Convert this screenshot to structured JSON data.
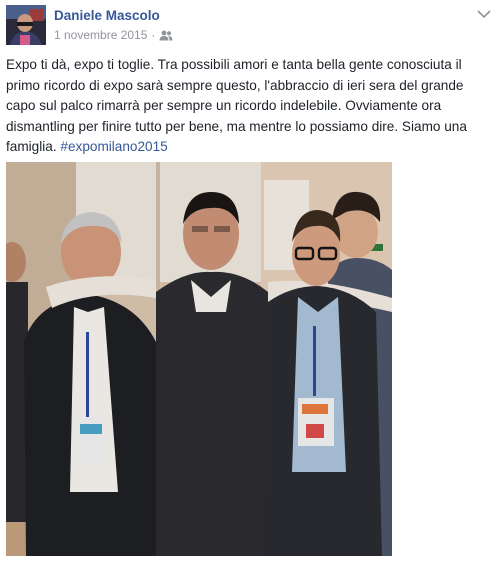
{
  "post": {
    "author": "Daniele Mascolo",
    "date": "1 novembre 2015",
    "separator": "·",
    "audience_icon": "friends-icon",
    "menu_icon": "chevron-down-icon",
    "text": "Expo ti dà, expo ti toglie. Tra possibili amori e tanta bella gente conosciuta il primo ricordo di expo sarà sempre questo, l'abbraccio di ieri sera del grande capo sul palco rimarrà per sempre un ricordo indelebile. Ovviamente ora dismantling per finire tutto per bene, ma mentre lo possiamo dire. Siamo una famiglia.",
    "hashtag": "#expomilano2015",
    "photo_description": "group-photo"
  },
  "colors": {
    "link": "#365899",
    "meta": "#90949c",
    "text": "#1d2129"
  }
}
